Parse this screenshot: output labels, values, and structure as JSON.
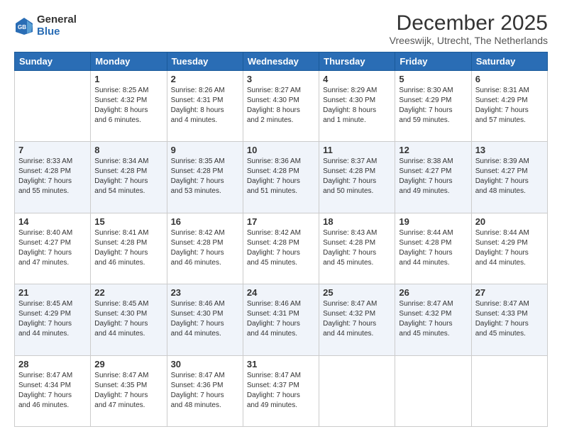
{
  "logo": {
    "general": "General",
    "blue": "Blue"
  },
  "header": {
    "title": "December 2025",
    "subtitle": "Vreeswijk, Utrecht, The Netherlands"
  },
  "days_of_week": [
    "Sunday",
    "Monday",
    "Tuesday",
    "Wednesday",
    "Thursday",
    "Friday",
    "Saturday"
  ],
  "weeks": [
    [
      {
        "day": "",
        "info": ""
      },
      {
        "day": "1",
        "info": "Sunrise: 8:25 AM\nSunset: 4:32 PM\nDaylight: 8 hours\nand 6 minutes."
      },
      {
        "day": "2",
        "info": "Sunrise: 8:26 AM\nSunset: 4:31 PM\nDaylight: 8 hours\nand 4 minutes."
      },
      {
        "day": "3",
        "info": "Sunrise: 8:27 AM\nSunset: 4:30 PM\nDaylight: 8 hours\nand 2 minutes."
      },
      {
        "day": "4",
        "info": "Sunrise: 8:29 AM\nSunset: 4:30 PM\nDaylight: 8 hours\nand 1 minute."
      },
      {
        "day": "5",
        "info": "Sunrise: 8:30 AM\nSunset: 4:29 PM\nDaylight: 7 hours\nand 59 minutes."
      },
      {
        "day": "6",
        "info": "Sunrise: 8:31 AM\nSunset: 4:29 PM\nDaylight: 7 hours\nand 57 minutes."
      }
    ],
    [
      {
        "day": "7",
        "info": "Sunrise: 8:33 AM\nSunset: 4:28 PM\nDaylight: 7 hours\nand 55 minutes."
      },
      {
        "day": "8",
        "info": "Sunrise: 8:34 AM\nSunset: 4:28 PM\nDaylight: 7 hours\nand 54 minutes."
      },
      {
        "day": "9",
        "info": "Sunrise: 8:35 AM\nSunset: 4:28 PM\nDaylight: 7 hours\nand 53 minutes."
      },
      {
        "day": "10",
        "info": "Sunrise: 8:36 AM\nSunset: 4:28 PM\nDaylight: 7 hours\nand 51 minutes."
      },
      {
        "day": "11",
        "info": "Sunrise: 8:37 AM\nSunset: 4:28 PM\nDaylight: 7 hours\nand 50 minutes."
      },
      {
        "day": "12",
        "info": "Sunrise: 8:38 AM\nSunset: 4:27 PM\nDaylight: 7 hours\nand 49 minutes."
      },
      {
        "day": "13",
        "info": "Sunrise: 8:39 AM\nSunset: 4:27 PM\nDaylight: 7 hours\nand 48 minutes."
      }
    ],
    [
      {
        "day": "14",
        "info": "Sunrise: 8:40 AM\nSunset: 4:27 PM\nDaylight: 7 hours\nand 47 minutes."
      },
      {
        "day": "15",
        "info": "Sunrise: 8:41 AM\nSunset: 4:28 PM\nDaylight: 7 hours\nand 46 minutes."
      },
      {
        "day": "16",
        "info": "Sunrise: 8:42 AM\nSunset: 4:28 PM\nDaylight: 7 hours\nand 46 minutes."
      },
      {
        "day": "17",
        "info": "Sunrise: 8:42 AM\nSunset: 4:28 PM\nDaylight: 7 hours\nand 45 minutes."
      },
      {
        "day": "18",
        "info": "Sunrise: 8:43 AM\nSunset: 4:28 PM\nDaylight: 7 hours\nand 45 minutes."
      },
      {
        "day": "19",
        "info": "Sunrise: 8:44 AM\nSunset: 4:28 PM\nDaylight: 7 hours\nand 44 minutes."
      },
      {
        "day": "20",
        "info": "Sunrise: 8:44 AM\nSunset: 4:29 PM\nDaylight: 7 hours\nand 44 minutes."
      }
    ],
    [
      {
        "day": "21",
        "info": "Sunrise: 8:45 AM\nSunset: 4:29 PM\nDaylight: 7 hours\nand 44 minutes."
      },
      {
        "day": "22",
        "info": "Sunrise: 8:45 AM\nSunset: 4:30 PM\nDaylight: 7 hours\nand 44 minutes."
      },
      {
        "day": "23",
        "info": "Sunrise: 8:46 AM\nSunset: 4:30 PM\nDaylight: 7 hours\nand 44 minutes."
      },
      {
        "day": "24",
        "info": "Sunrise: 8:46 AM\nSunset: 4:31 PM\nDaylight: 7 hours\nand 44 minutes."
      },
      {
        "day": "25",
        "info": "Sunrise: 8:47 AM\nSunset: 4:32 PM\nDaylight: 7 hours\nand 44 minutes."
      },
      {
        "day": "26",
        "info": "Sunrise: 8:47 AM\nSunset: 4:32 PM\nDaylight: 7 hours\nand 45 minutes."
      },
      {
        "day": "27",
        "info": "Sunrise: 8:47 AM\nSunset: 4:33 PM\nDaylight: 7 hours\nand 45 minutes."
      }
    ],
    [
      {
        "day": "28",
        "info": "Sunrise: 8:47 AM\nSunset: 4:34 PM\nDaylight: 7 hours\nand 46 minutes."
      },
      {
        "day": "29",
        "info": "Sunrise: 8:47 AM\nSunset: 4:35 PM\nDaylight: 7 hours\nand 47 minutes."
      },
      {
        "day": "30",
        "info": "Sunrise: 8:47 AM\nSunset: 4:36 PM\nDaylight: 7 hours\nand 48 minutes."
      },
      {
        "day": "31",
        "info": "Sunrise: 8:47 AM\nSunset: 4:37 PM\nDaylight: 7 hours\nand 49 minutes."
      },
      {
        "day": "",
        "info": ""
      },
      {
        "day": "",
        "info": ""
      },
      {
        "day": "",
        "info": ""
      }
    ]
  ]
}
